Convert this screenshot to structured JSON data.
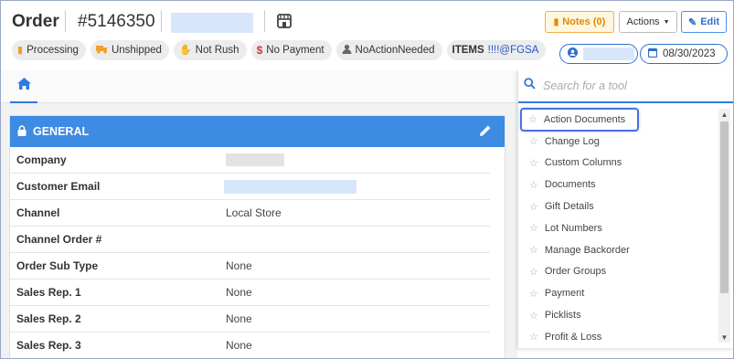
{
  "header": {
    "title": "Order",
    "order_number": "#5146350",
    "notes_label": "Notes (0)",
    "actions_label": "Actions",
    "edit_label": "Edit",
    "date": "08/30/2023"
  },
  "badges": [
    {
      "icon": "bookmark-icon",
      "label": "Processing",
      "color": "#f0a030"
    },
    {
      "icon": "truck-icon",
      "label": "Unshipped",
      "color": "#f0a030"
    },
    {
      "icon": "hand-icon",
      "label": "Not Rush",
      "color": "#666666"
    },
    {
      "icon": "dollar-icon",
      "label": "No Payment",
      "color": "#d9333f"
    },
    {
      "icon": "user-icon",
      "label": "NoActionNeeded",
      "color": "#666666"
    }
  ],
  "items_badge": {
    "label": "ITEMS",
    "value": "!!!!@FGSA"
  },
  "panel": {
    "title": "GENERAL",
    "rows": [
      {
        "label": "Company",
        "value": ""
      },
      {
        "label": "Customer Email",
        "value": ""
      },
      {
        "label": "Channel",
        "value": "Local Store"
      },
      {
        "label": "Channel Order #",
        "value": ""
      },
      {
        "label": "Order Sub Type",
        "value": "None"
      },
      {
        "label": "Sales Rep. 1",
        "value": "None"
      },
      {
        "label": "Sales Rep. 2",
        "value": "None"
      },
      {
        "label": "Sales Rep. 3",
        "value": "None"
      }
    ]
  },
  "tools": {
    "search_placeholder": "Search for a tool",
    "items": [
      "Action Documents",
      "Change Log",
      "Custom Columns",
      "Documents",
      "Gift Details",
      "Lot Numbers",
      "Manage Backorder",
      "Order Groups",
      "Payment",
      "Picklists",
      "Profit & Loss"
    ]
  },
  "colors": {
    "accent": "#3d8be3",
    "notes": "#f0ad4e",
    "highlight": "#4a6fe0"
  }
}
